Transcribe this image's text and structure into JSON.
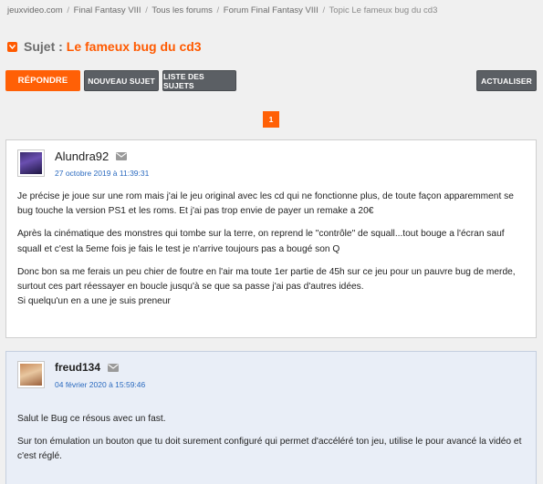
{
  "breadcrumb": {
    "items": [
      "jeuxvideo.com",
      "Final Fantasy VIII",
      "Tous les forums",
      "Forum Final Fantasy VIII"
    ],
    "current": "Topic Le fameux bug du cd3",
    "separator": "/"
  },
  "subject": {
    "prefix": "Sujet :",
    "title": "Le fameux bug du cd3"
  },
  "toolbar": {
    "reply_label": "Répondre",
    "new_topic_label": "Nouveau sujet",
    "topic_list_label": "Liste des sujets",
    "refresh_label": "Actualiser"
  },
  "pagination": {
    "current_page": "1"
  },
  "posts": [
    {
      "author": "Alundra92",
      "date": "27 octobre 2019 à 11:39:31",
      "paragraphs": [
        "Je précise je joue sur une rom mais j'ai le jeu original avec les cd qui ne fonctionne plus, de toute façon apparemment se bug touche la version PS1 et les roms. Et j'ai pas trop envie de payer un remake a 20€",
        "Après la cinématique des monstres qui tombe sur la terre, on reprend le \"contrôle\" de squall...tout bouge a l'écran sauf squall et c'est la 5eme fois je fais le test je n'arrive toujours pas a bougé son Q",
        "Donc bon sa me ferais un peu chier de foutre en l'air ma toute 1er partie de 45h sur ce jeu pour un pauvre bug de merde, surtout ces part réessayer en boucle jusqu'à se que sa passe j'ai pas d'autres idées.",
        "Si quelqu'un en a une je suis preneur"
      ]
    },
    {
      "author": "freud134",
      "date": "04 février 2020 à 15:59:46",
      "paragraphs": [
        "Salut le Bug ce résous avec un fast.",
        "Sur ton émulation un bouton que tu doit surement configuré qui permet d'accéléré ton jeu, utilise le pour avancé la vidéo et c'est réglé."
      ]
    }
  ],
  "colors": {
    "accent": "#ff6006",
    "link_date": "#2a6abf",
    "secondary_button": "#5b5f64",
    "highlight_post_bg": "#e9eef7"
  }
}
